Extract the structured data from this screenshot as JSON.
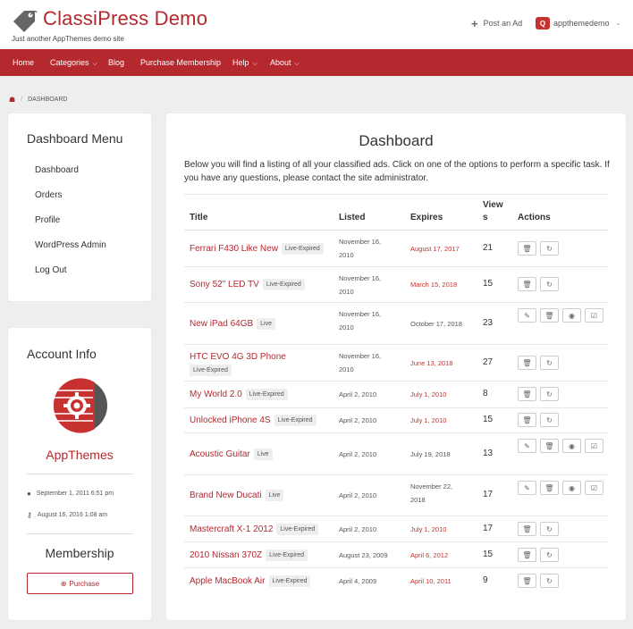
{
  "header": {
    "site_title": "ClassiPress Demo",
    "tagline": "Just another AppThemes demo site",
    "post_ad_label": "Post an Ad",
    "username": "appthemedemo",
    "logo_icon": "price-tag-icon",
    "brand_color": "#b4282e"
  },
  "nav": {
    "items": [
      {
        "label": "Home",
        "dropdown": false
      },
      {
        "label": "Categories",
        "dropdown": true
      },
      {
        "label": "Blog",
        "dropdown": false
      },
      {
        "label": "Purchase Membership",
        "dropdown": false
      },
      {
        "label": "Help",
        "dropdown": true
      },
      {
        "label": "About",
        "dropdown": true
      }
    ]
  },
  "breadcrumb": {
    "separator": "/",
    "current": "DASHBOARD"
  },
  "dashboard_menu": {
    "title": "Dashboard Menu",
    "items": [
      "Dashboard",
      "Orders",
      "Profile",
      "WordPress Admin",
      "Log Out"
    ]
  },
  "account_info": {
    "title": "Account Info",
    "name": "AppThemes",
    "registered": "September 1, 2011 6:51 pm",
    "last_login": "August 16, 2016 1:08 am",
    "membership_title": "Membership",
    "purchase_label": "Purchase"
  },
  "dashboard": {
    "title": "Dashboard",
    "description": "Below you will find a listing of all your classified ads. Click on one of the options to perform a specific task. If you have any questions, please contact the site administrator.",
    "columns": {
      "title": "Title",
      "listed": "Listed",
      "expires": "Expires",
      "views_line1": "View",
      "views_line2": "s",
      "actions": "Actions"
    },
    "rows": [
      {
        "title": "Ferrari F430 Like New",
        "status": "Live-Expired",
        "listed1": "November 16,",
        "listed2": "2010",
        "expires1": "August 17, 2017",
        "expires2": "",
        "expired": true,
        "views": "21",
        "editable": false
      },
      {
        "title": "Sony 52\" LED TV",
        "status": "Live-Expired",
        "listed1": "November 16,",
        "listed2": "2010",
        "expires1": "March 15, 2018",
        "expires2": "",
        "expired": true,
        "views": "15",
        "editable": false
      },
      {
        "title": "New iPad 64GB",
        "status": "Live",
        "listed1": "November 16,",
        "listed2": "2010",
        "expires1": "October 17, 2018",
        "expires2": "",
        "expired": false,
        "views": "23",
        "editable": true
      },
      {
        "title": "HTC EVO 4G 3D Phone",
        "status": "Live-Expired",
        "listed1": "November 16,",
        "listed2": "2010",
        "expires1": "June 13, 2018",
        "expires2": "",
        "expired": true,
        "views": "27",
        "editable": false
      },
      {
        "title": "My World 2.0",
        "status": "Live-Expired",
        "listed1": "April 2, 2010",
        "listed2": "",
        "expires1": "July 1, 2010",
        "expires2": "",
        "expired": true,
        "views": "8",
        "editable": false
      },
      {
        "title": "Unlocked iPhone 4S",
        "status": "Live-Expired",
        "listed1": "April 2, 2010",
        "listed2": "",
        "expires1": "July 1, 2010",
        "expires2": "",
        "expired": true,
        "views": "15",
        "editable": false
      },
      {
        "title": "Acoustic Guitar",
        "status": "Live",
        "listed1": "April 2, 2010",
        "listed2": "",
        "expires1": "July 19, 2018",
        "expires2": "",
        "expired": false,
        "views": "13",
        "editable": true
      },
      {
        "title": "Brand New Ducati",
        "status": "Live",
        "listed1": "April 2, 2010",
        "listed2": "",
        "expires1": "November 22,",
        "expires2": "2018",
        "expired": false,
        "views": "17",
        "editable": true
      },
      {
        "title": "Mastercraft X-1 2012",
        "status": "Live-Expired",
        "listed1": "April 2, 2010",
        "listed2": "",
        "expires1": "July 1, 2010",
        "expires2": "",
        "expired": true,
        "views": "17",
        "editable": false
      },
      {
        "title": "2010 Nissan 370Z",
        "status": "Live-Expired",
        "listed1": "August 23, 2009",
        "listed2": "",
        "expires1": "April 6, 2012",
        "expires2": "",
        "expired": true,
        "views": "15",
        "editable": false
      },
      {
        "title": "Apple MacBook Air",
        "status": "Live-Expired",
        "listed1": "April 4, 2009",
        "listed2": "",
        "expires1": "April 10, 2011",
        "expires2": "",
        "expired": true,
        "views": "9",
        "editable": false
      }
    ]
  }
}
